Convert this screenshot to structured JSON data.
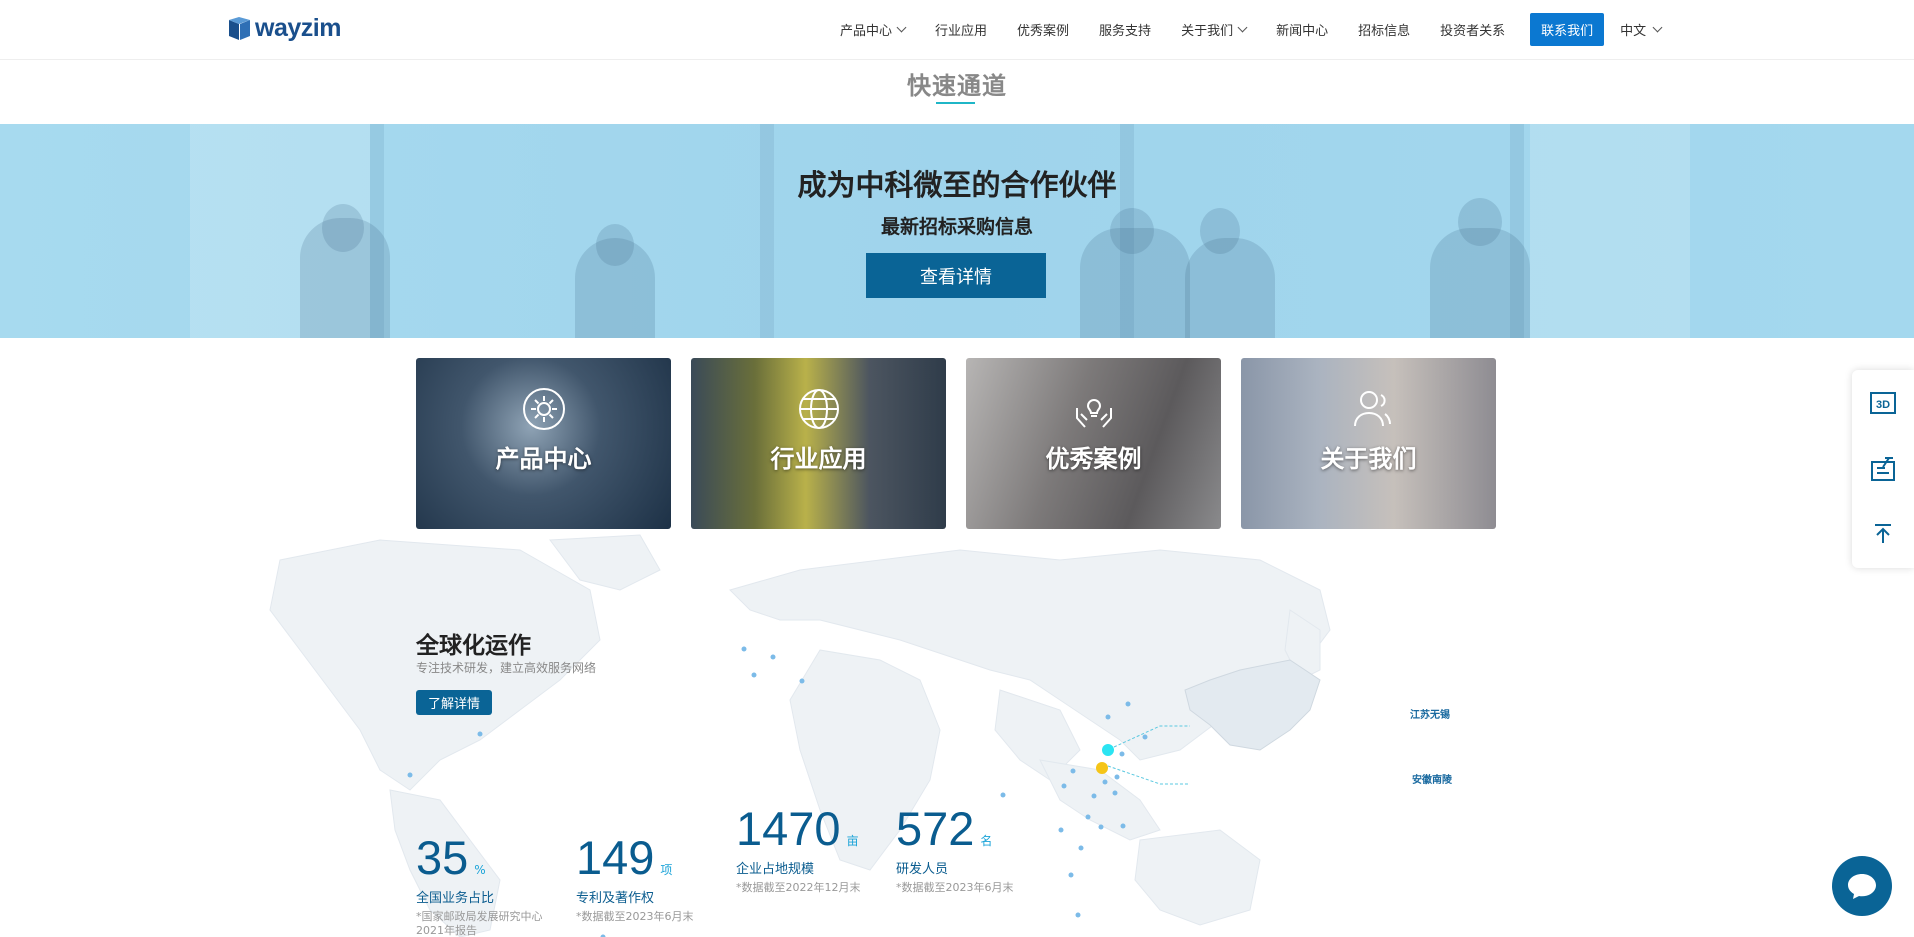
{
  "header": {
    "logo_text": "wayzim",
    "nav": [
      {
        "label": "产品中心",
        "has_dropdown": true
      },
      {
        "label": "行业应用",
        "has_dropdown": false
      },
      {
        "label": "优秀案例",
        "has_dropdown": false
      },
      {
        "label": "服务支持",
        "has_dropdown": false
      },
      {
        "label": "关于我们",
        "has_dropdown": true
      },
      {
        "label": "新闻中心",
        "has_dropdown": false
      },
      {
        "label": "招标信息",
        "has_dropdown": false
      },
      {
        "label": "投资者关系",
        "has_dropdown": false
      }
    ],
    "contact_label": "联系我们",
    "language": "中文"
  },
  "section": {
    "title": "快速通道"
  },
  "banner": {
    "title": "成为中科微至的合作伙伴",
    "subtitle": "最新招标采购信息",
    "button_label": "查看详情"
  },
  "cards": [
    {
      "label": "产品中心",
      "icon": "gear-icon"
    },
    {
      "label": "行业应用",
      "icon": "globe-icon"
    },
    {
      "label": "优秀案例",
      "icon": "lightbulb-hands-icon"
    },
    {
      "label": "关于我们",
      "icon": "users-icon"
    }
  ],
  "global": {
    "title": "全球化运作",
    "subtitle": "专注技术研发，建立高效服务网络",
    "button_label": "了解详情",
    "map_labels": [
      "江苏无锡",
      "安徽南陵"
    ]
  },
  "stats": [
    {
      "value": "35",
      "unit": "%",
      "label": "全国业务占比",
      "note": "*国家邮政局发展研究中心2021年报告"
    },
    {
      "value": "149",
      "unit": "项",
      "label": "专利及著作权",
      "note": "*数据截至2023年6月末"
    },
    {
      "value": "1470",
      "unit": "亩",
      "label": "企业占地规模",
      "note": "*数据截至2022年12月末"
    },
    {
      "value": "572",
      "unit": "名",
      "label": "研发人员",
      "note": "*数据截至2023年6月末"
    }
  ],
  "side_toolbar": {
    "items": [
      {
        "icon": "3d-icon",
        "glyph": "3D"
      },
      {
        "icon": "edit-form-icon"
      },
      {
        "icon": "back-to-top-icon"
      }
    ]
  },
  "colors": {
    "brand": "#0a6496",
    "accent": "#0b78d1",
    "teal": "#1fb6c7",
    "banner": "#a7daef"
  }
}
